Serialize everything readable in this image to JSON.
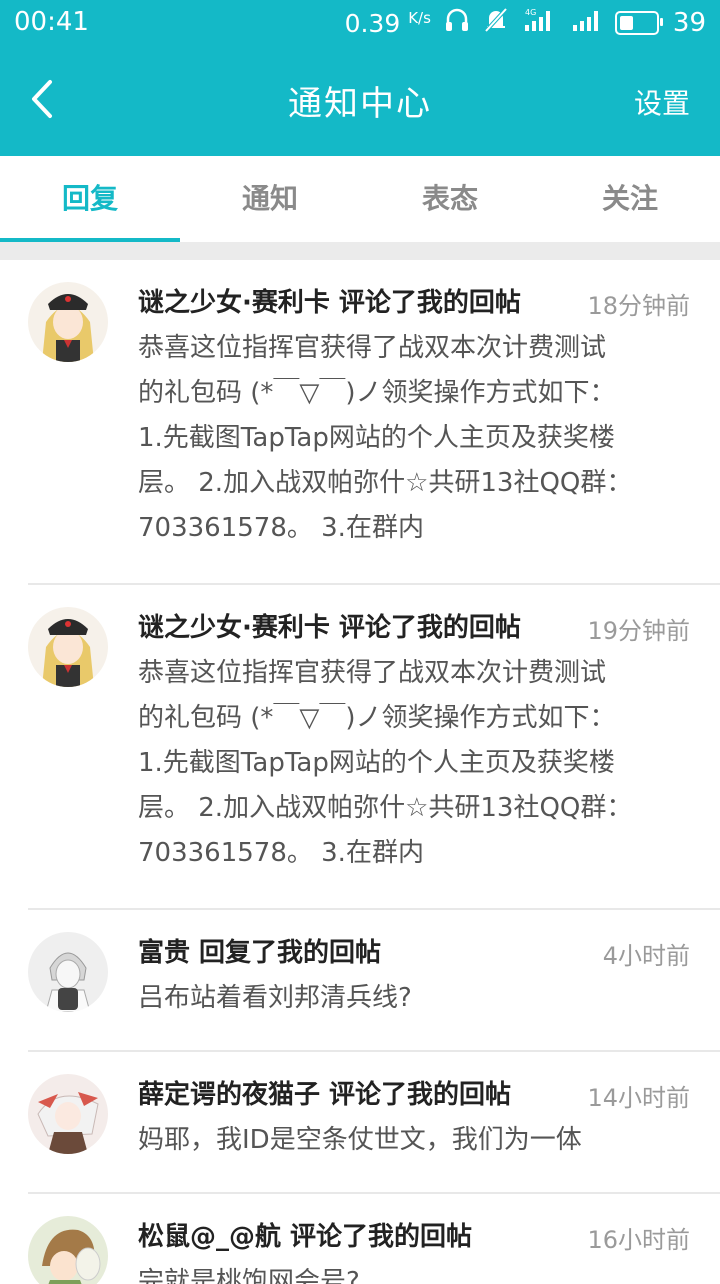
{
  "status_bar": {
    "time": "00:41",
    "speed": "0.39",
    "speed_unit": "K/s",
    "network": "4G",
    "battery": "39",
    "battery_level": 0.39
  },
  "header": {
    "title": "通知中心",
    "settings_label": "设置"
  },
  "tabs": [
    {
      "label": "回复",
      "active": true
    },
    {
      "label": "通知",
      "active": false
    },
    {
      "label": "表态",
      "active": false
    },
    {
      "label": "关注",
      "active": false
    }
  ],
  "notifications": [
    {
      "user_action": "谜之少女·赛利卡 评论了我的回帖",
      "time": "18分钟前",
      "lines": [
        "恭喜这位指挥官获得了战双本次计费测试",
        "的礼包码 (*￣▽￣)ノ领奖操作方式如下：",
        "1.先截图TapTap网站的个人主页及获奖楼",
        "层。 2.加入战双帕弥什☆共研13社QQ群：",
        "703361578。 3.在群内"
      ],
      "avatar": "anime-girl-avatar"
    },
    {
      "user_action": "谜之少女·赛利卡 评论了我的回帖",
      "time": "19分钟前",
      "lines": [
        "恭喜这位指挥官获得了战双本次计费测试",
        "的礼包码 (*￣▽￣)ノ领奖操作方式如下：",
        "1.先截图TapTap网站的个人主页及获奖楼",
        "层。 2.加入战双帕弥什☆共研13社QQ群：",
        "703361578。 3.在群内"
      ],
      "avatar": "anime-girl-avatar"
    },
    {
      "user_action": "富贵 回复了我的回帖",
      "time": "4小时前",
      "lines": [
        "吕布站着看刘邦清兵线?"
      ],
      "avatar": "sketch-boy-avatar"
    },
    {
      "user_action": "薛定谔的夜猫子 评论了我的回帖",
      "time": "14小时前",
      "lines": [
        "妈耶，我ID是空条仗世文，我们为一体"
      ],
      "avatar": "white-hair-avatar"
    },
    {
      "user_action": "松鼠@_@航 评论了我的回帖",
      "time": "16小时前",
      "lines": [
        "完就是桃饱网会号?"
      ],
      "avatar": "brown-hair-avatar"
    }
  ],
  "colors": {
    "accent": "#14b9c7",
    "text_primary": "#222222",
    "text_secondary": "#555555",
    "text_muted": "#9a9a9a"
  }
}
